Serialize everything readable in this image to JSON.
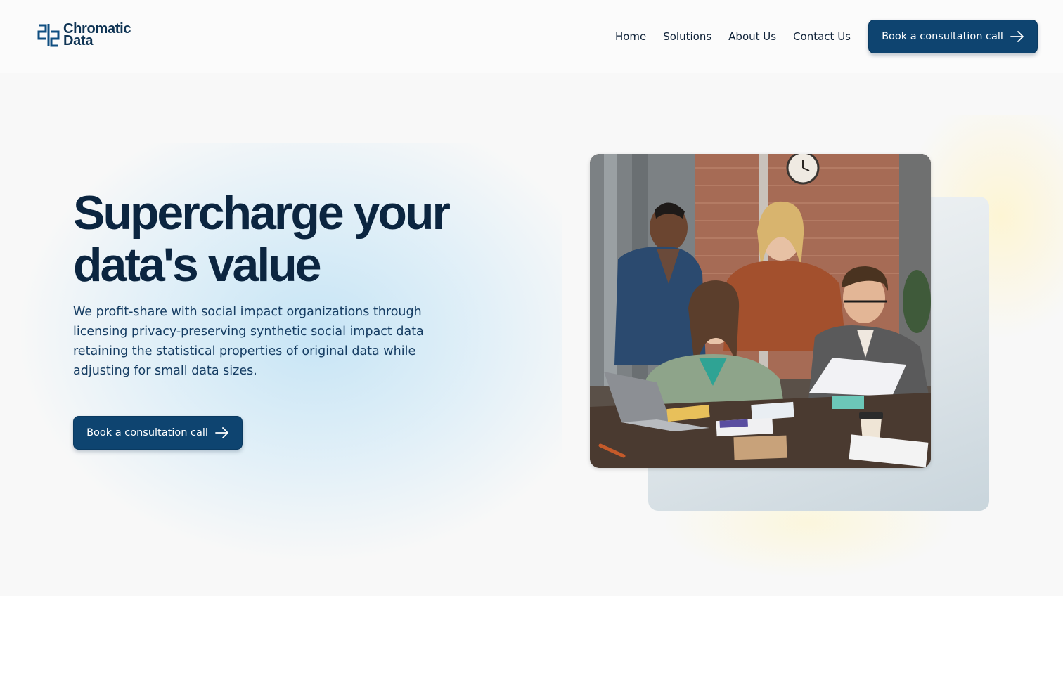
{
  "header": {
    "logo": {
      "line1": "Chromatic",
      "line2": "Data"
    },
    "nav": [
      "Home",
      "Solutions",
      "About Us",
      "Contact Us"
    ],
    "cta_label": "Book a consultation call"
  },
  "hero": {
    "title": "Supercharge your data's value",
    "description": "We profit-share with social impact organizations through licensing privacy-preserving synthetic social impact data retaining the statistical properties of original data while adjusting for small data sizes.",
    "cta_label": "Book a consultation call",
    "image_icon": "team-meeting-photo"
  },
  "colors": {
    "brand": "#0e4470",
    "heading": "#0b2540",
    "body_text": "#163d63",
    "hero_bg": "#f8f8f8"
  }
}
